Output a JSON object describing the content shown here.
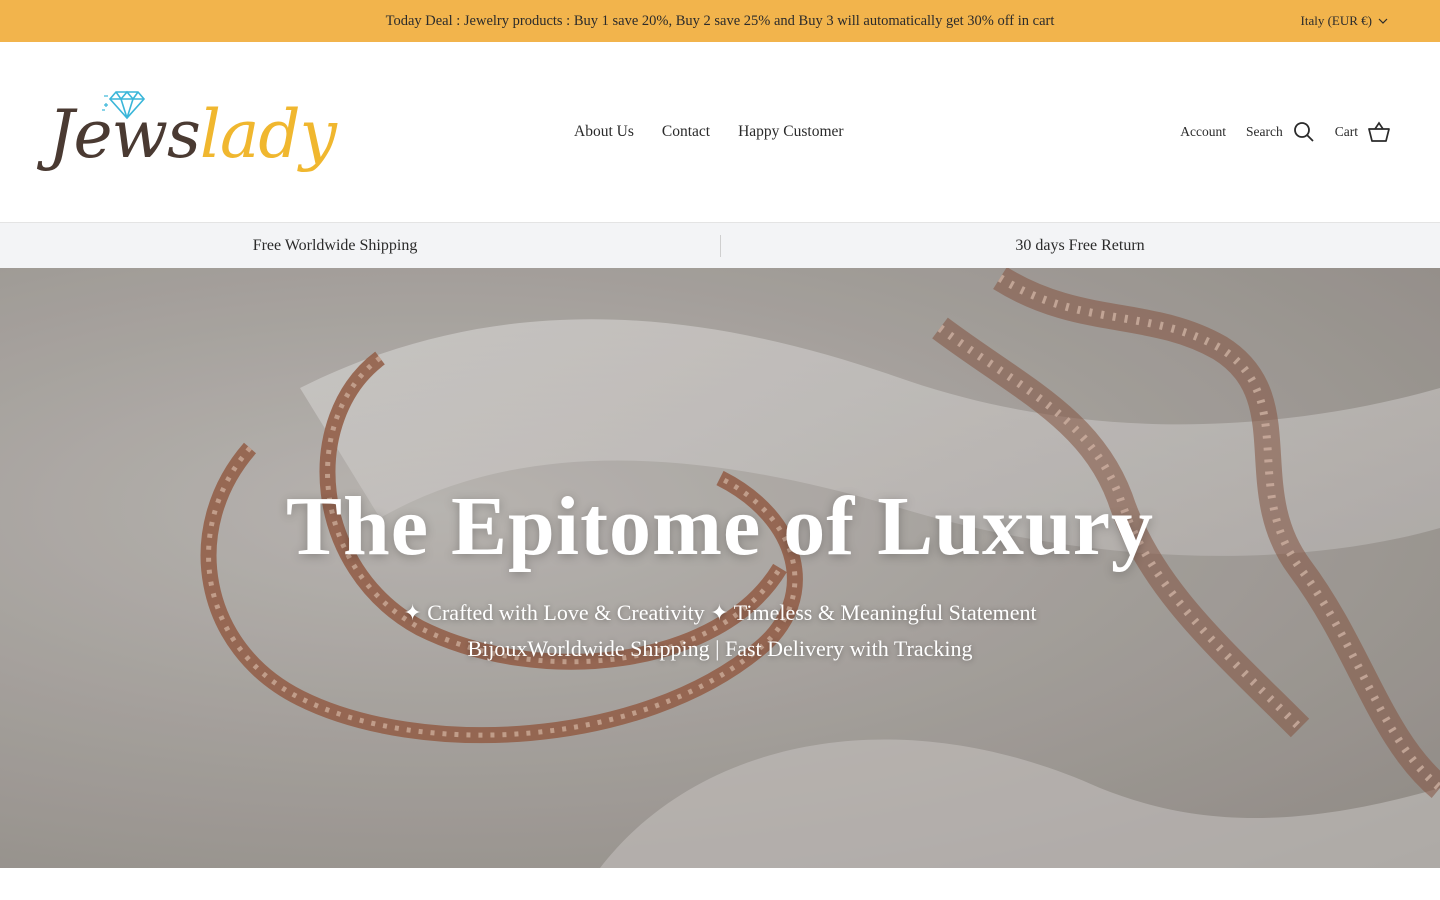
{
  "announcement": {
    "text": "Today Deal : Jewelry products : Buy 1 save 20%, Buy 2 save 25% and Buy 3 will automatically get 30% off in cart",
    "currency": "Italy (EUR €)"
  },
  "brand": {
    "logo_part1": "Jews",
    "logo_part2": "lady"
  },
  "nav": {
    "items": [
      {
        "label": "About Us"
      },
      {
        "label": "Contact"
      },
      {
        "label": "Happy Customer"
      }
    ]
  },
  "tools": {
    "account": "Account",
    "search": "Search",
    "cart": "Cart"
  },
  "usp": {
    "left": "Free Worldwide Shipping",
    "right": "30 days Free Return"
  },
  "hero": {
    "title": "The Epitome of Luxury",
    "line1": "✦ Crafted with Love & Creativity ✦ Timeless & Meaningful Statement",
    "line2": "BijouxWorldwide Shipping | Fast Delivery with Tracking"
  },
  "colors": {
    "announcement_bg": "#f2b44c",
    "logo_dark": "#4a3a32",
    "logo_gold": "#f0b72f",
    "usp_bg": "#f3f4f6"
  },
  "icons": [
    "chevron-down-icon",
    "diamond-icon",
    "search-icon",
    "cart-icon"
  ]
}
